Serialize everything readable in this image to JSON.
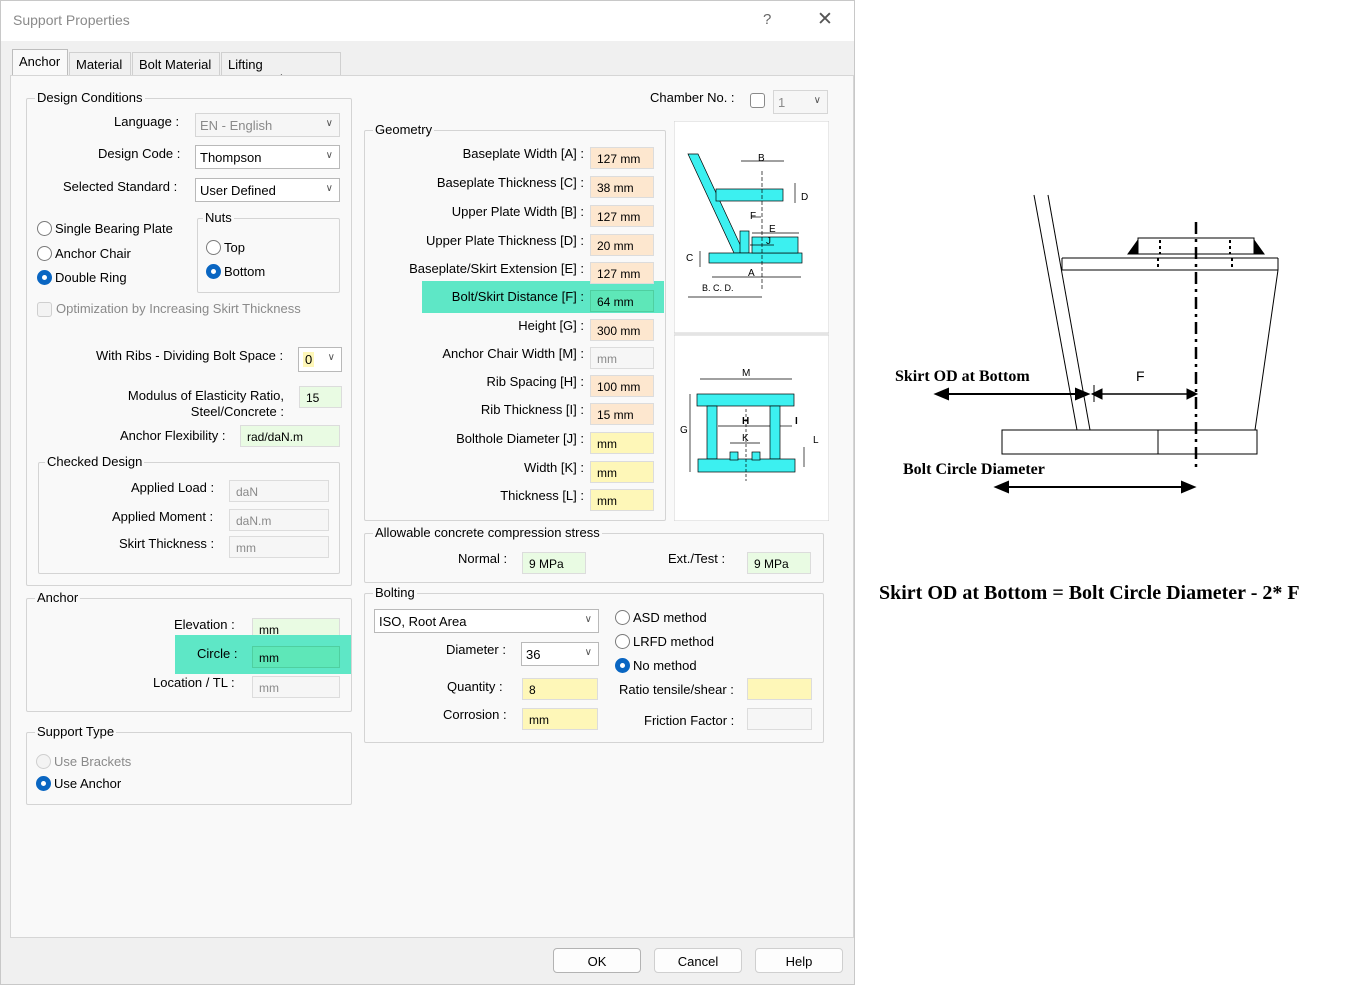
{
  "window": {
    "title": "Support Properties",
    "help_label": "?",
    "close_label": "✕"
  },
  "tabs": [
    {
      "label": "Anchor"
    },
    {
      "label": "Material"
    },
    {
      "label": "Bolt Material"
    },
    {
      "label": "Lifting accessories"
    }
  ],
  "design_conditions": {
    "title": "Design Conditions",
    "language_label": "Language :",
    "language_value": "EN - English",
    "design_code_label": "Design Code :",
    "design_code_value": "Thompson",
    "standard_label": "Selected Standard :",
    "standard_value": "User Defined",
    "type_options": [
      {
        "label": "Single Bearing Plate",
        "selected": false
      },
      {
        "label": "Anchor Chair",
        "selected": false
      },
      {
        "label": "Double Ring",
        "selected": true
      }
    ],
    "nuts": {
      "title": "Nuts",
      "options": [
        {
          "label": "Top",
          "selected": false
        },
        {
          "label": "Bottom",
          "selected": true
        }
      ]
    },
    "optimization_label": "Optimization by Increasing Skirt Thickness",
    "ribs_label": "With Ribs - Dividing Bolt Space :",
    "ribs_value": "0",
    "modulus_label": "Modulus of Elasticity Ratio,\nSteel/Concrete :",
    "modulus_value": "15",
    "flex_label": "Anchor Flexibility :",
    "flex_value": "rad/daN.m",
    "checked_design": {
      "title": "Checked Design",
      "applied_load_label": "Applied Load :",
      "applied_load_value": "daN",
      "applied_moment_label": "Applied Moment :",
      "applied_moment_value": "daN.m",
      "skirt_thickness_label": "Skirt Thickness :",
      "skirt_thickness_value": "mm"
    }
  },
  "anchor": {
    "title": "Anchor",
    "elevation_label": "Elevation :",
    "elevation_value": "mm",
    "circle_label": "Circle :",
    "circle_value": "mm",
    "location_label": "Location / TL :",
    "location_value": "mm"
  },
  "support_type": {
    "title": "Support Type",
    "options": [
      {
        "label": "Use Brackets",
        "selected": false,
        "disabled": true
      },
      {
        "label": "Use Anchor",
        "selected": true,
        "disabled": false
      }
    ]
  },
  "chamber": {
    "label": "Chamber No. :",
    "value": "1",
    "checked": false
  },
  "geometry": {
    "title": "Geometry",
    "rows": [
      {
        "label": "Baseplate Width [A] :",
        "value": "127 mm",
        "style": "or"
      },
      {
        "label": "Baseplate Thickness [C] :",
        "value": "38 mm",
        "style": "or"
      },
      {
        "label": "Upper Plate Width [B] :",
        "value": "127 mm",
        "style": "or"
      },
      {
        "label": "Upper Plate Thickness [D] :",
        "value": "20 mm",
        "style": "or"
      },
      {
        "label": "Baseplate/Skirt Extension [E] :",
        "value": "127 mm",
        "style": "or"
      },
      {
        "label": "Bolt/Skirt Distance [F] :",
        "value": "64 mm",
        "style": "hl"
      },
      {
        "label": "Height [G] :",
        "value": "300 mm",
        "style": "or"
      },
      {
        "label": "Anchor Chair Width [M] :",
        "value": "mm",
        "style": "gy"
      },
      {
        "label": "Rib Spacing [H] :",
        "value": "100 mm",
        "style": "or"
      },
      {
        "label": "Rib Thickness [I] :",
        "value": "15 mm",
        "style": "or"
      },
      {
        "label": "Bolthole Diameter [J] :",
        "value": "mm",
        "style": "ye"
      },
      {
        "label": "Width [K] :",
        "value": "mm",
        "style": "ye"
      },
      {
        "label": "Thickness [L] :",
        "value": "mm",
        "style": "ye"
      }
    ]
  },
  "concrete": {
    "title": "Allowable concrete compression stress",
    "normal_label": "Normal :",
    "normal_value": "9 MPa",
    "ext_label": "Ext./Test :",
    "ext_value": "9 MPa"
  },
  "bolting": {
    "title": "Bolting",
    "standard_value": "ISO, Root Area",
    "diameter_label": "Diameter :",
    "diameter_value": "36",
    "quantity_label": "Quantity :",
    "quantity_value": "8",
    "corrosion_label": "Corrosion :",
    "corrosion_value": "mm",
    "methods": [
      {
        "label": "ASD method",
        "selected": false
      },
      {
        "label": "LRFD method",
        "selected": false
      },
      {
        "label": "No method",
        "selected": true
      }
    ],
    "ratio_label": "Ratio tensile/shear :",
    "ratio_value": "",
    "friction_label": "Friction Factor :",
    "friction_value": ""
  },
  "chair_labels": {
    "b": "B",
    "d": "D",
    "f": "F",
    "e": "E",
    "j": "J",
    "c": "C",
    "a": "A",
    "bcd": "B. C. D."
  },
  "rib_labels": {
    "m": "M",
    "h": "H",
    "i": "I",
    "g": "G",
    "k": "K",
    "l": "L"
  },
  "buttons": {
    "ok": "OK",
    "cancel": "Cancel",
    "help": "Help"
  },
  "diagram": {
    "skirt_label": "Skirt OD at Bottom",
    "f_label": "F",
    "bcd_label": "Bolt Circle Diameter",
    "equation": "Skirt OD at Bottom = Bolt Circle Diameter - 2* F"
  },
  "colors": {
    "highlight": "#5ee7c6",
    "input_orange": "#fde7cf",
    "input_yellow": "#fef7b8",
    "accent": "#0a66c2",
    "drawing_cyan": "#3cf0f0"
  }
}
